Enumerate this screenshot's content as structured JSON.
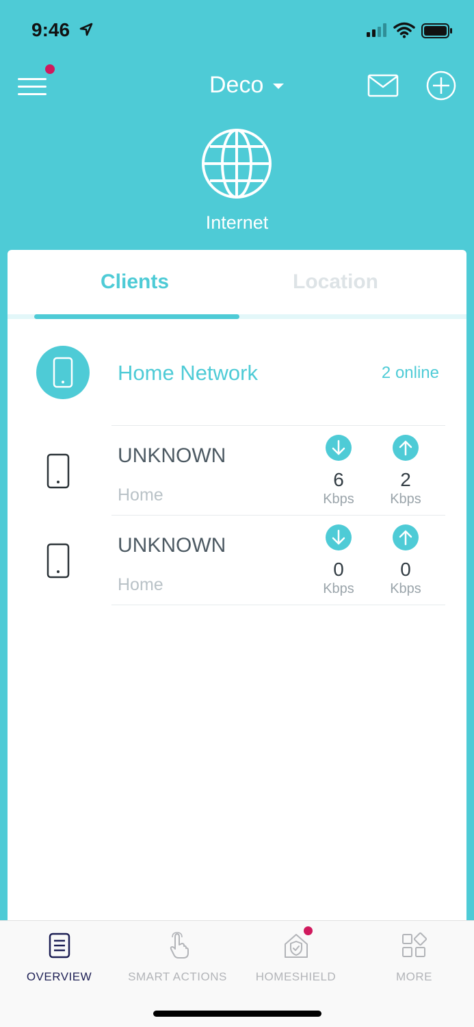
{
  "status_bar": {
    "time": "9:46"
  },
  "header": {
    "title": "Deco",
    "icons": {
      "menu": "hamburger-menu-icon",
      "mail": "mail-icon",
      "add": "plus-circle-icon"
    }
  },
  "internet": {
    "label": "Internet",
    "icon": "globe-icon"
  },
  "tabs": [
    {
      "label": "Clients",
      "active": true
    },
    {
      "label": "Location",
      "active": false
    }
  ],
  "network": {
    "name": "Home Network",
    "count": "2 online",
    "icon": "phone-icon"
  },
  "clients": [
    {
      "name": "UNKNOWN",
      "location": "Home",
      "download": {
        "value": "6",
        "unit": "Kbps"
      },
      "upload": {
        "value": "2",
        "unit": "Kbps"
      }
    },
    {
      "name": "UNKNOWN",
      "location": "Home",
      "download": {
        "value": "0",
        "unit": "Kbps"
      },
      "upload": {
        "value": "0",
        "unit": "Kbps"
      }
    }
  ],
  "bottom_nav": [
    {
      "label": "OVERVIEW",
      "icon": "overview-icon",
      "active": true
    },
    {
      "label": "SMART ACTIONS",
      "icon": "tap-hand-icon",
      "active": false
    },
    {
      "label": "HOMESHIELD",
      "icon": "house-shield-icon",
      "active": false,
      "badge": true
    },
    {
      "label": "MORE",
      "icon": "grid-more-icon",
      "active": false
    }
  ],
  "colors": {
    "accent": "#4ecbd6",
    "badge": "#d0195d",
    "nav_active": "#1d1f54",
    "nav_inactive": "#b2b4b8"
  }
}
